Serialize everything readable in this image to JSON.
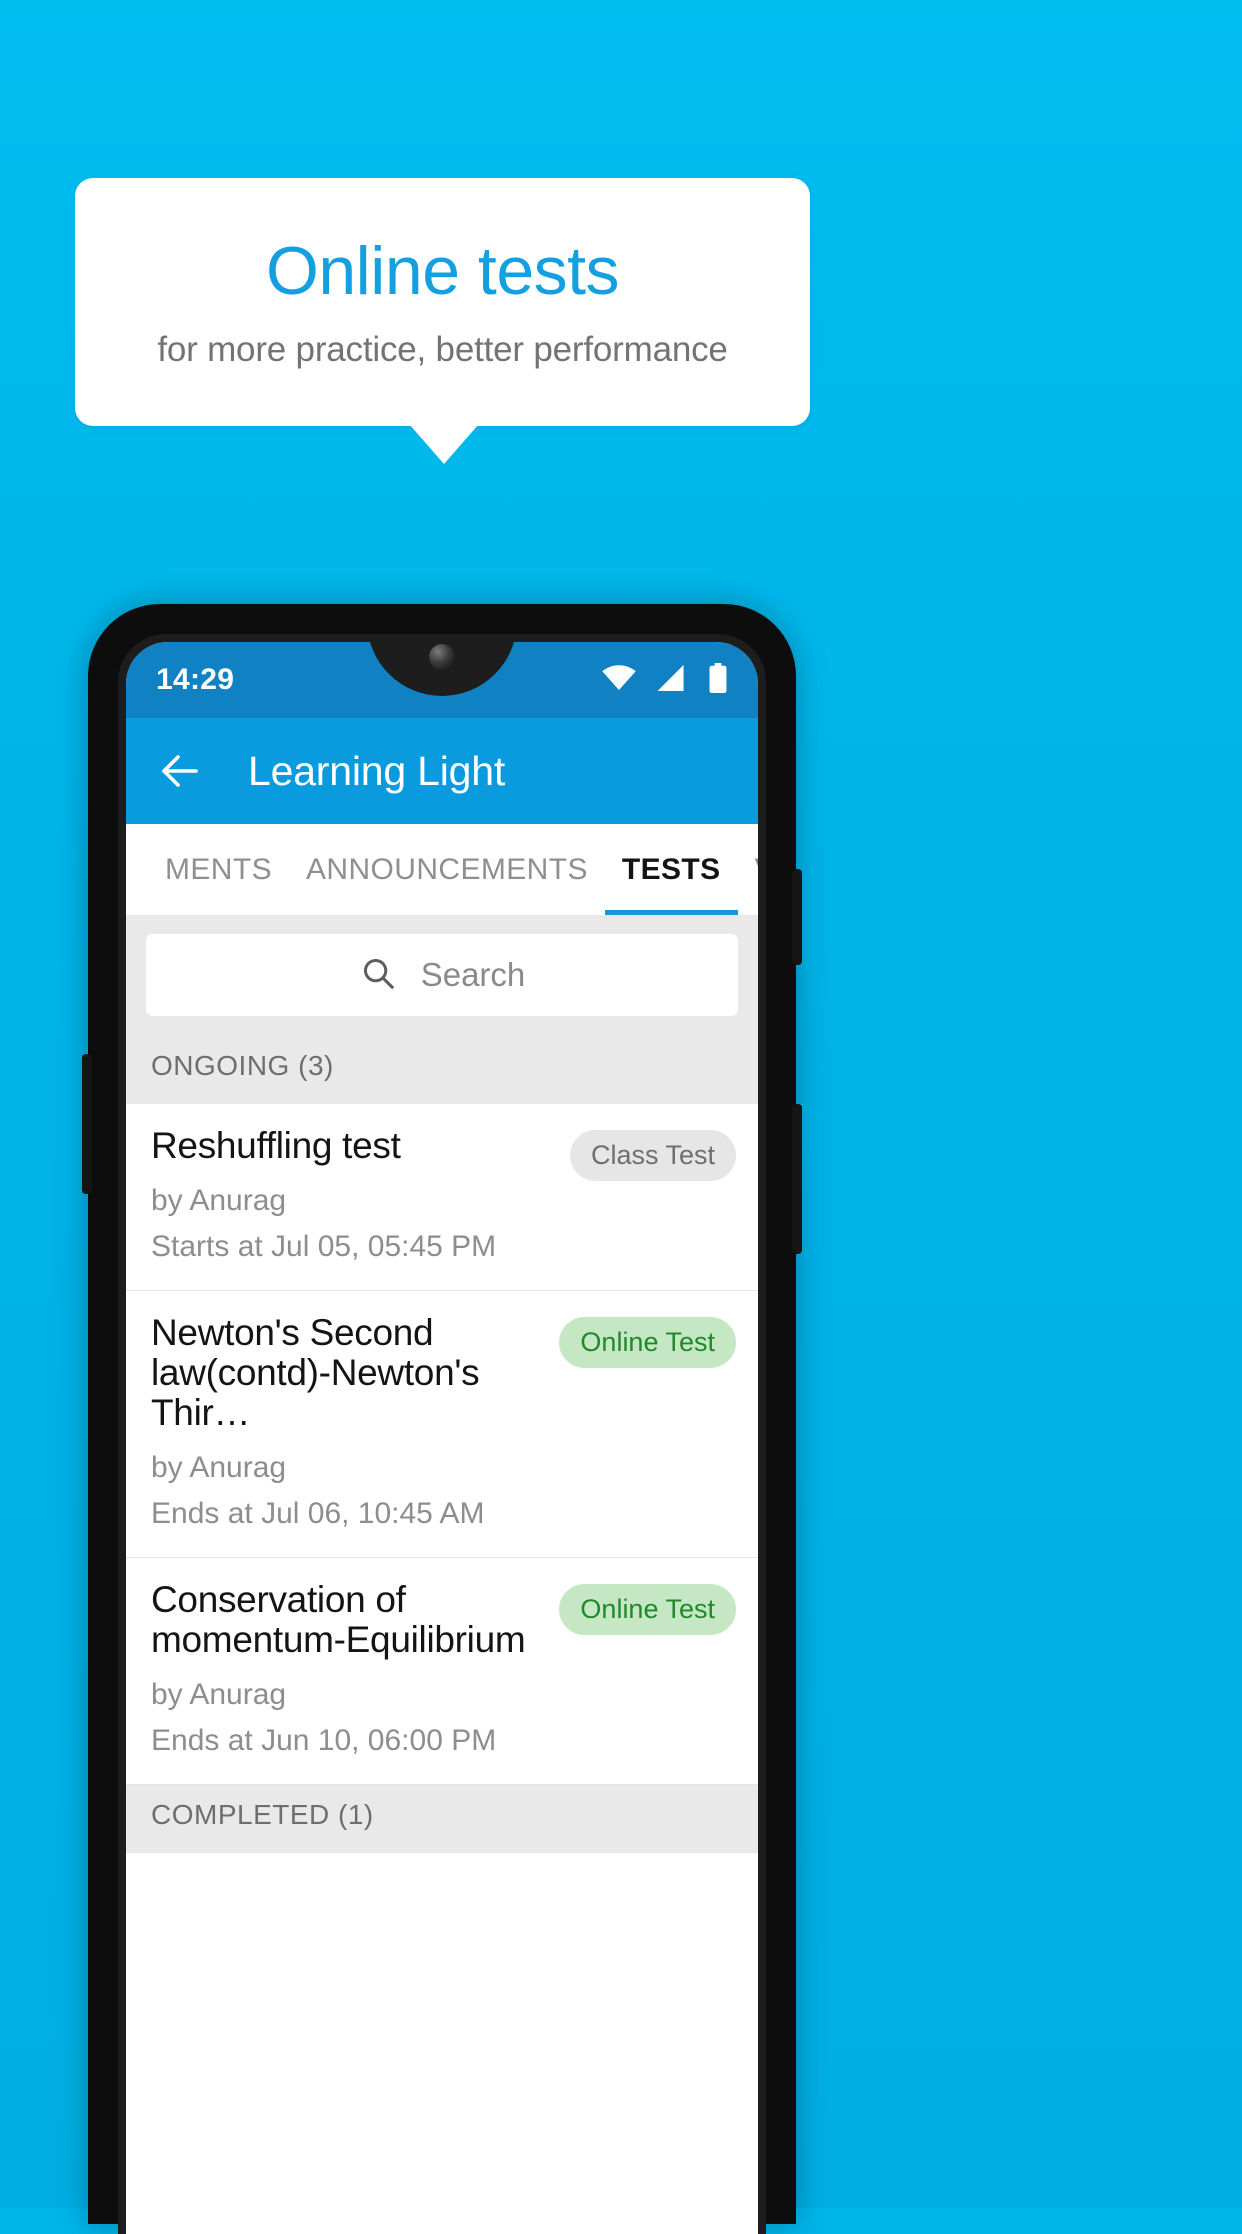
{
  "promo": {
    "title": "Online tests",
    "subtitle": "for more practice, better performance",
    "accent_color": "#14a0e0",
    "background_color": "#00b5ea"
  },
  "phone": {
    "status_bar": {
      "time": "14:29",
      "icons": [
        "wifi-icon",
        "signal-icon",
        "battery-icon"
      ],
      "background_color": "#1082c4"
    },
    "app_bar": {
      "back_icon": "back-arrow-icon",
      "title": "Learning Light",
      "background_color": "#0a9ade"
    },
    "tabs": [
      {
        "label": "MENTS",
        "active": false
      },
      {
        "label": "ANNOUNCEMENTS",
        "active": false
      },
      {
        "label": "TESTS",
        "active": true
      },
      {
        "label": "VIDEOS",
        "active": false
      }
    ],
    "search": {
      "icon": "search-icon",
      "placeholder": "Search",
      "value": ""
    },
    "sections": [
      {
        "header": "ONGOING (3)",
        "items": [
          {
            "title": "Reshuffling test",
            "author": "by Anurag",
            "schedule": "Starts at  Jul 05, 05:45 PM",
            "badge": "Class Test",
            "badge_style": "grey"
          },
          {
            "title": "Newton's Second law(contd)-Newton's Thir…",
            "author": "by Anurag",
            "schedule": "Ends at  Jul 06, 10:45 AM",
            "badge": "Online Test",
            "badge_style": "green"
          },
          {
            "title": "Conservation of momentum-Equilibrium",
            "author": "by Anurag",
            "schedule": "Ends at  Jun 10, 06:00 PM",
            "badge": "Online Test",
            "badge_style": "green"
          }
        ]
      },
      {
        "header": "COMPLETED (1)",
        "items": []
      }
    ]
  }
}
